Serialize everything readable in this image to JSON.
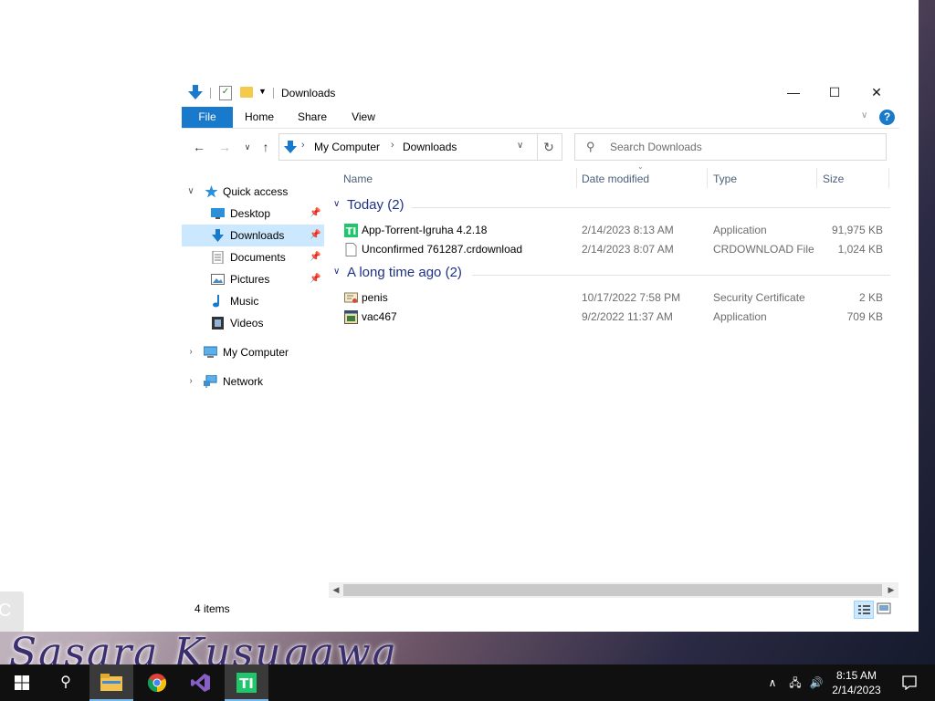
{
  "window": {
    "title": "Downloads",
    "minimize_label": "—",
    "maximize_label": "☐",
    "close_label": "✕"
  },
  "ribbon": {
    "tabs": [
      {
        "label": "File"
      },
      {
        "label": "Home"
      },
      {
        "label": "Share"
      },
      {
        "label": "View"
      }
    ],
    "help_label": "?"
  },
  "address": {
    "crumbs": [
      "My Computer",
      "Downloads"
    ]
  },
  "search": {
    "placeholder": "Search Downloads"
  },
  "navpane": {
    "quick_access": "Quick access",
    "items": [
      {
        "label": "Desktop",
        "icon": "desktop-icon",
        "pinned": true
      },
      {
        "label": "Downloads",
        "icon": "downloads-icon",
        "pinned": true,
        "selected": true
      },
      {
        "label": "Documents",
        "icon": "documents-icon",
        "pinned": true
      },
      {
        "label": "Pictures",
        "icon": "pictures-icon",
        "pinned": true
      },
      {
        "label": "Music",
        "icon": "music-icon",
        "pinned": false
      },
      {
        "label": "Videos",
        "icon": "videos-icon",
        "pinned": false
      }
    ],
    "my_computer": "My Computer",
    "network": "Network"
  },
  "columns": {
    "name": "Name",
    "date": "Date modified",
    "type": "Type",
    "size": "Size"
  },
  "groups": [
    {
      "label": "Today (2)",
      "files": [
        {
          "name": "App-Torrent-Igruha 4.2.18",
          "date": "2/14/2023 8:13 AM",
          "type": "Application",
          "size": "91,975 KB",
          "icon": "app-torrent-icon"
        },
        {
          "name": "Unconfirmed 761287.crdownload",
          "date": "2/14/2023 8:07 AM",
          "type": "CRDOWNLOAD File",
          "size": "1,024 KB",
          "icon": "blank-file-icon"
        }
      ]
    },
    {
      "label": "A long time ago (2)",
      "files": [
        {
          "name": "penis",
          "date": "10/17/2022 7:58 PM",
          "type": "Security Certificate",
          "size": "2 KB",
          "icon": "certificate-icon"
        },
        {
          "name": "vac467",
          "date": "9/2/2022 11:37 AM",
          "type": "Application",
          "size": "709 KB",
          "icon": "application-icon"
        }
      ]
    }
  ],
  "status": {
    "item_count": "4 items"
  },
  "wallpaper": {
    "text": "Sasara Kusugawa"
  },
  "taskbar": {
    "time": "8:15 AM",
    "date": "2/14/2023"
  },
  "colors": {
    "accent": "#1979ca",
    "selection": "#cce8ff",
    "group_header": "#1e3287",
    "taskbar": "#101010"
  }
}
